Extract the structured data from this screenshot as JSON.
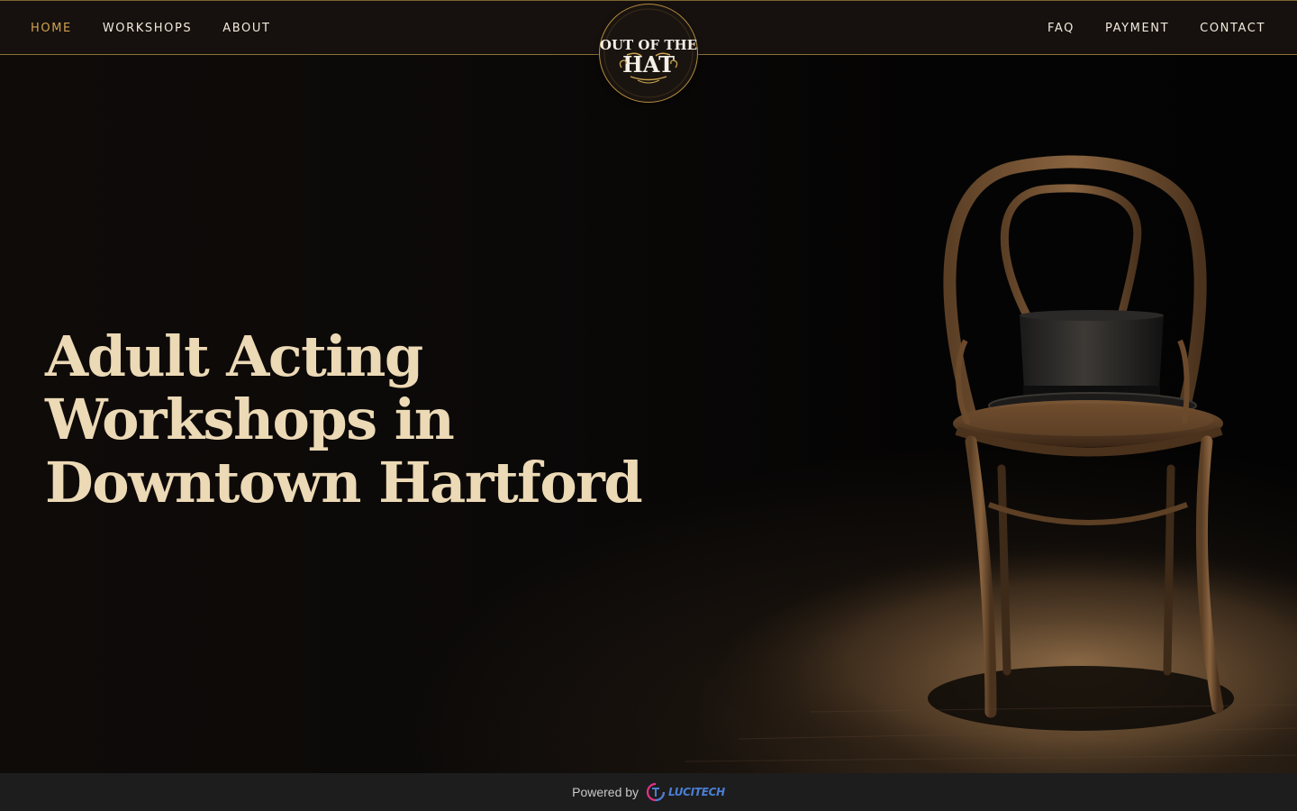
{
  "nav": {
    "left": [
      {
        "label": "HOME",
        "active": true
      },
      {
        "label": "WORKSHOPS",
        "active": false
      },
      {
        "label": "ABOUT",
        "active": false
      }
    ],
    "right": [
      {
        "label": "FAQ"
      },
      {
        "label": "PAYMENT"
      },
      {
        "label": "CONTACT"
      }
    ]
  },
  "logo": {
    "line1": "OUT OF THE",
    "line2": "HAT"
  },
  "hero": {
    "title_lines": [
      "Adult Acting",
      "Workshops in",
      "Downtown Hartford"
    ],
    "image_subject": "chair-with-top-hat-illustration"
  },
  "footer": {
    "powered_label": "Powered by",
    "brand_name": "LUCITECH",
    "brand_icon": "lucitech-logo-icon"
  },
  "colors": {
    "nav_bg": "#16110e",
    "nav_border": "#8c7238",
    "nav_text": "#f1e9dc",
    "nav_active": "#d2a24d",
    "hero_title": "#ecd9b5",
    "footer_bg": "#1d1d1d",
    "brand_blue": "#4a7fd4",
    "brand_pink": "#e0338a"
  }
}
